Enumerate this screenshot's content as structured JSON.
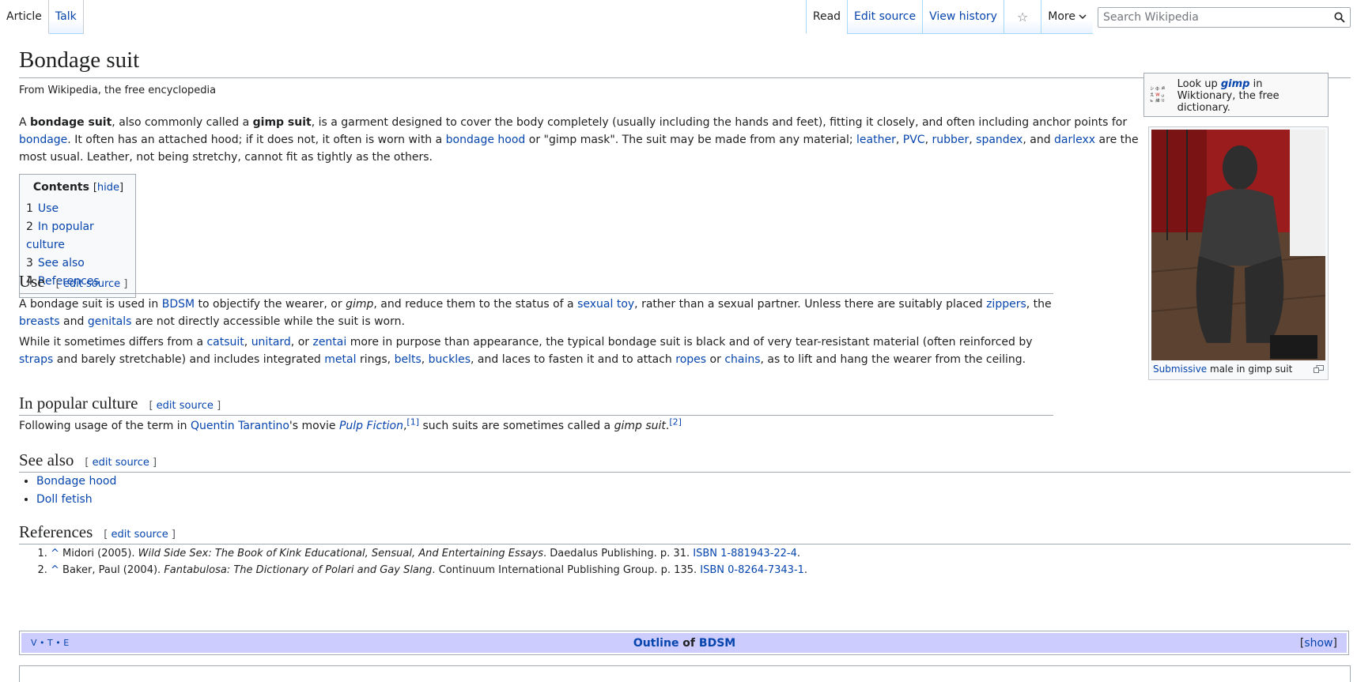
{
  "tabs": {
    "article": "Article",
    "talk": "Talk",
    "read": "Read",
    "edit_source": "Edit source",
    "view_history": "View history",
    "more": "More",
    "search_placeholder": "Search Wikipedia"
  },
  "page": {
    "title": "Bondage suit",
    "tagline": "From Wikipedia, the free encyclopedia"
  },
  "lead": {
    "t1": "A ",
    "b1": "bondage suit",
    "t2": ", also commonly called a ",
    "b2": "gimp suit",
    "t3": ", is a garment designed to cover the body completely (usually including the hands and feet), fitting it closely, and often including anchor points for ",
    "l1": "bondage",
    "t4": ". It often has an attached hood; if it does not, it often is worn with a ",
    "l2": "bondage hood",
    "t5": " or \"gimp mask\". The suit may be made from any material; ",
    "l3": "leather",
    "t6": ", ",
    "l4": "PVC",
    "t7": ", ",
    "l5": "rubber",
    "t8": ", ",
    "l6": "spandex",
    "t9": ", and ",
    "l7": "darlexx",
    "t10": " are the most usual. Leather, not being stretchy, cannot fit as tightly as the others."
  },
  "toc": {
    "title": "Contents",
    "hide": "hide",
    "items": [
      {
        "num": "1",
        "label": "Use"
      },
      {
        "num": "2",
        "label": "In popular culture"
      },
      {
        "num": "3",
        "label": "See also"
      },
      {
        "num": "4",
        "label": "References"
      }
    ]
  },
  "sections": {
    "edit_label": "edit source",
    "use": {
      "heading": "Use",
      "p1": {
        "t1": "A bondage suit is used in ",
        "l1": "BDSM",
        "t2": " to objectify the wearer, or ",
        "i1": "gimp",
        "t3": ", and reduce them to the status of a ",
        "l2": "sexual toy",
        "t4": ", rather than a sexual partner. Unless there are suitably placed ",
        "l3": "zippers",
        "t5": ", the ",
        "l4": "breasts",
        "t6": " and ",
        "l5": "genitals",
        "t7": " are not directly accessible while the suit is worn."
      },
      "p2": {
        "t1": "While it sometimes differs from a ",
        "l1": "catsuit",
        "t2": ", ",
        "l2": "unitard",
        "t3": ", or ",
        "l3": "zentai",
        "t4": " more in purpose than appearance, the typical bondage suit is black and of very tear-resistant material (often reinforced by ",
        "l4": "straps",
        "t5": " and barely stretchable) and includes integrated ",
        "l5": "metal",
        "t6": " rings, ",
        "l6": "belts",
        "t7": ", ",
        "l7": "buckles",
        "t8": ", and laces to fasten it and to attach ",
        "l8": "ropes",
        "t9": " or ",
        "l9": "chains",
        "t10": ", as to lift and hang the wearer from the ceiling."
      }
    },
    "culture": {
      "heading": "In popular culture",
      "t1": "Following usage of the term in ",
      "l1": "Quentin Tarantino",
      "t2": "'s movie ",
      "l2": "Pulp Fiction",
      "t3": ",",
      "ref1": "[1]",
      "t4": " such suits are sometimes called a ",
      "i1": "gimp suit",
      "t5": ".",
      "ref2": "[2]"
    },
    "see_also": {
      "heading": "See also",
      "items": [
        "Bondage hood",
        "Doll fetish"
      ]
    },
    "references": {
      "heading": "References",
      "items": [
        {
          "caret": "^",
          "author": "Midori (2005). ",
          "work": "Wild Side Sex: The Book of Kink Educational, Sensual, And Entertaining Essays",
          "rest": ". Daedalus Publishing. p. 31. ",
          "isbn": "ISBN 1-881943-22-4",
          "end": "."
        },
        {
          "caret": "^",
          "author": "Baker, Paul (2004). ",
          "work": "Fantabulosa: The Dictionary of Polari and Gay Slang",
          "rest": ". Continuum International Publishing Group. p. 135. ",
          "isbn": "ISBN 0-8264-7343-1",
          "end": "."
        }
      ]
    }
  },
  "navbox": {
    "vte": "V • T • E",
    "title_link": "Outline",
    "title_of": " of ",
    "title_link2": "BDSM",
    "show": "show"
  },
  "wiktionary": {
    "t1": "Look up ",
    "word": "gimp",
    "t2": " in Wiktionary, the free dictionary."
  },
  "figure": {
    "caption_link": "Submissive",
    "caption_rest": " male in gimp suit"
  }
}
